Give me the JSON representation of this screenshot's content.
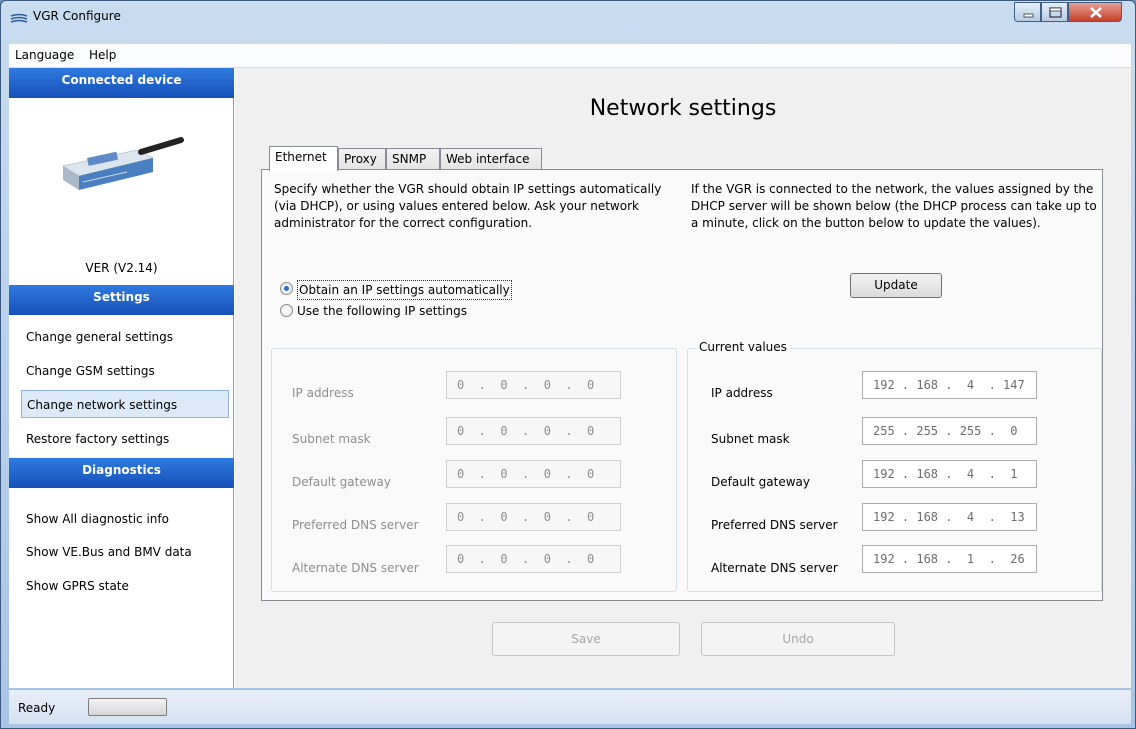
{
  "window": {
    "title": "VGR Configure",
    "icon": "vgr-app-icon",
    "controls": [
      "minimize-icon",
      "maximize-icon",
      "close-icon"
    ]
  },
  "menu": {
    "items": [
      "Language",
      "Help"
    ]
  },
  "sidebar": {
    "connected_device_header": "Connected device",
    "device_version": "VER (V2.14)",
    "settings_header": "Settings",
    "settings_items": [
      "Change general settings",
      "Change GSM settings",
      "Change network settings",
      "Restore factory settings"
    ],
    "selected_item": "Change network settings",
    "diagnostics_header": "Diagnostics",
    "diagnostics_items": [
      "Show All diagnostic info",
      "Show VE.Bus and BMV data",
      "Show GPRS state"
    ]
  },
  "main": {
    "title": "Network settings",
    "tabs": [
      "Ethernet",
      "Proxy",
      "SNMP",
      "Web interface"
    ],
    "active_tab": "Ethernet",
    "description_left": "Specify whether the VGR should obtain IP settings automatically (via DHCP), or using values entered below.  Ask your network administrator for the correct configuration.",
    "description_right": "If the VGR is connected to the network, the values assigned by the DHCP server will be shown below (the DHCP process can take up to a minute, click on the button below to update the values).",
    "update_button": "Update",
    "radio_auto": "Obtain an IP settings automatically",
    "radio_manual": "Use the following IP settings",
    "radio_auto_checked": true,
    "current_values_title": "Current values",
    "field_labels": [
      "IP address",
      "Subnet mask",
      "Default gateway",
      "Preferred DNS server",
      "Alternate DNS server"
    ],
    "manual_values": [
      "0  .  0  .  0  .  0",
      "0  .  0  .  0  .  0",
      "0  .  0  .  0  .  0",
      "0  .  0  .  0  .  0",
      "0  .  0  .  0  .  0"
    ],
    "current_values": [
      "192 . 168 .  4  . 147",
      "255 . 255 . 255 .  0",
      "192 . 168 .  4  .  1",
      "192 . 168 .  4  .  13",
      "192 . 168 .  1  .  26"
    ],
    "save_button": "Save",
    "undo_button": "Undo"
  },
  "status": {
    "text": "Ready"
  },
  "colors": {
    "sidebar_header": "#1f63cf",
    "selection": "#dce9f8",
    "close_button": "#c5402a"
  }
}
